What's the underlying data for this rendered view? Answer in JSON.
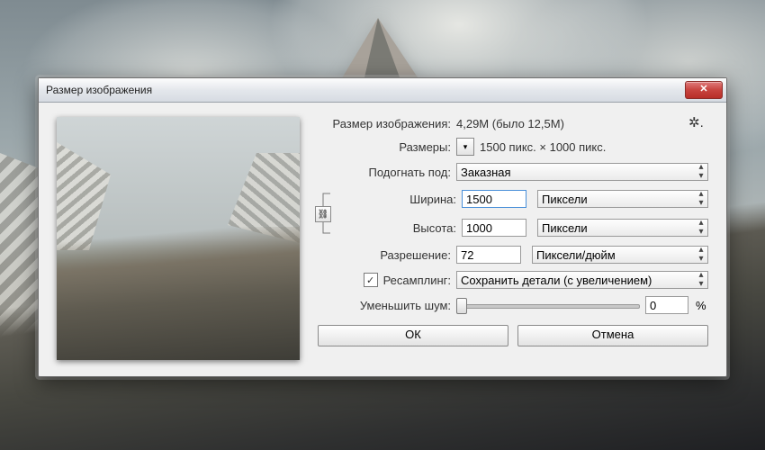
{
  "window": {
    "title": "Размер изображения"
  },
  "info": {
    "size_label": "Размер изображения:",
    "size_value": "4,29M (было 12,5M)",
    "dims_label": "Размеры:",
    "dims_value": "1500 пикс. × 1000 пикс."
  },
  "fit": {
    "label": "Подогнать под:",
    "value": "Заказная"
  },
  "width": {
    "label": "Ширина:",
    "value": "1500",
    "unit": "Пиксели"
  },
  "height": {
    "label": "Высота:",
    "value": "1000",
    "unit": "Пиксели"
  },
  "resolution": {
    "label": "Разрешение:",
    "value": "72",
    "unit": "Пиксели/дюйм"
  },
  "resample": {
    "label": "Ресамплинг:",
    "value": "Сохранить детали (с увеличением)",
    "checked": true
  },
  "noise": {
    "label": "Уменьшить шум:",
    "value": "0",
    "suffix": "%"
  },
  "buttons": {
    "ok": "ОК",
    "cancel": "Отмена"
  }
}
